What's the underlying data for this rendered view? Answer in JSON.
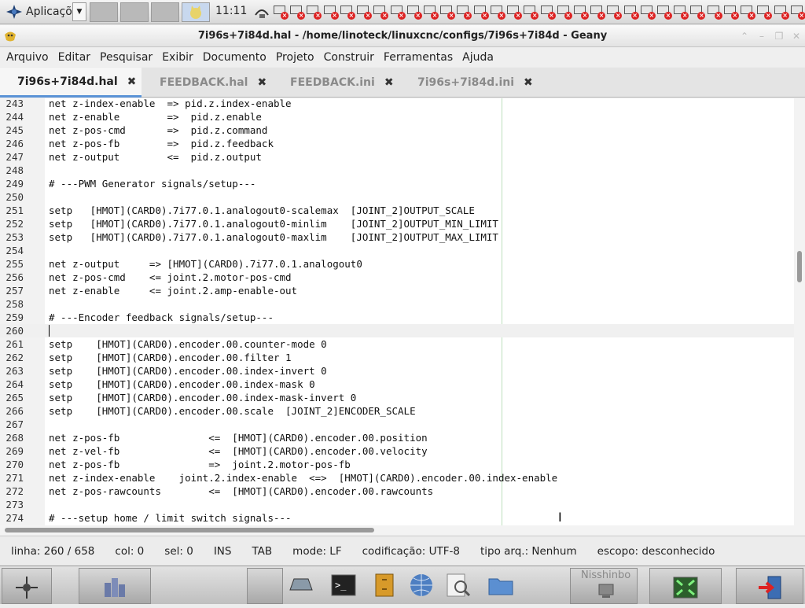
{
  "top_panel": {
    "app_menu_label": "Aplicaçõe",
    "clock": "11:11",
    "tray_count": 32
  },
  "window": {
    "title": "7i96s+7i84d.hal - /home/linoteck/linuxcnc/configs/7i96s+7i84d - Geany"
  },
  "menubar": [
    "Arquivo",
    "Editar",
    "Pesquisar",
    "Exibir",
    "Documento",
    "Projeto",
    "Construir",
    "Ferramentas",
    "Ajuda"
  ],
  "tabs": [
    {
      "label": "7i96s+7i84d.hal",
      "active": true
    },
    {
      "label": "FEEDBACK.hal",
      "active": false
    },
    {
      "label": "FEEDBACK.ini",
      "active": false
    },
    {
      "label": "7i96s+7i84d.ini",
      "active": false
    }
  ],
  "tab_close_glyph": "✖",
  "editor": {
    "current_line": 260,
    "lines": [
      {
        "n": "243",
        "t": "net z-index-enable  => pid.z.index-enable"
      },
      {
        "n": "244",
        "t": "net z-enable        =>  pid.z.enable"
      },
      {
        "n": "245",
        "t": "net z-pos-cmd       =>  pid.z.command"
      },
      {
        "n": "246",
        "t": "net z-pos-fb        =>  pid.z.feedback"
      },
      {
        "n": "247",
        "t": "net z-output        <=  pid.z.output"
      },
      {
        "n": "248",
        "t": ""
      },
      {
        "n": "249",
        "t": "# ---PWM Generator signals/setup---"
      },
      {
        "n": "250",
        "t": ""
      },
      {
        "n": "251",
        "t": "setp   [HMOT](CARD0).7i77.0.1.analogout0-scalemax  [JOINT_2]OUTPUT_SCALE"
      },
      {
        "n": "252",
        "t": "setp   [HMOT](CARD0).7i77.0.1.analogout0-minlim    [JOINT_2]OUTPUT_MIN_LIMIT"
      },
      {
        "n": "253",
        "t": "setp   [HMOT](CARD0).7i77.0.1.analogout0-maxlim    [JOINT_2]OUTPUT_MAX_LIMIT"
      },
      {
        "n": "254",
        "t": ""
      },
      {
        "n": "255",
        "t": "net z-output     => [HMOT](CARD0).7i77.0.1.analogout0"
      },
      {
        "n": "256",
        "t": "net z-pos-cmd    <= joint.2.motor-pos-cmd"
      },
      {
        "n": "257",
        "t": "net z-enable     <= joint.2.amp-enable-out"
      },
      {
        "n": "258",
        "t": ""
      },
      {
        "n": "259",
        "t": "# ---Encoder feedback signals/setup---"
      },
      {
        "n": "260",
        "t": ""
      },
      {
        "n": "261",
        "t": "setp    [HMOT](CARD0).encoder.00.counter-mode 0"
      },
      {
        "n": "262",
        "t": "setp    [HMOT](CARD0).encoder.00.filter 1"
      },
      {
        "n": "263",
        "t": "setp    [HMOT](CARD0).encoder.00.index-invert 0"
      },
      {
        "n": "264",
        "t": "setp    [HMOT](CARD0).encoder.00.index-mask 0"
      },
      {
        "n": "265",
        "t": "setp    [HMOT](CARD0).encoder.00.index-mask-invert 0"
      },
      {
        "n": "266",
        "t": "setp    [HMOT](CARD0).encoder.00.scale  [JOINT_2]ENCODER_SCALE"
      },
      {
        "n": "267",
        "t": ""
      },
      {
        "n": "268",
        "t": "net z-pos-fb               <=  [HMOT](CARD0).encoder.00.position"
      },
      {
        "n": "269",
        "t": "net z-vel-fb               <=  [HMOT](CARD0).encoder.00.velocity"
      },
      {
        "n": "270",
        "t": "net z-pos-fb               =>  joint.2.motor-pos-fb"
      },
      {
        "n": "271",
        "t": "net z-index-enable    joint.2.index-enable  <=>  [HMOT](CARD0).encoder.00.index-enable"
      },
      {
        "n": "272",
        "t": "net z-pos-rawcounts        <=  [HMOT](CARD0).encoder.00.rawcounts"
      },
      {
        "n": "273",
        "t": ""
      },
      {
        "n": "274",
        "t": "# ---setup home / limit switch signals---"
      }
    ]
  },
  "statusbar": {
    "line": "linha: 260 / 658",
    "col": "col: 0",
    "sel": "sel: 0",
    "ins": "INS",
    "tab": "TAB",
    "mode": "mode: LF",
    "encoding": "codificação: UTF-8",
    "filetype": "tipo arq.: Nenhum",
    "scope": "escopo: desconhecido"
  },
  "dock": {
    "nisshinbo_label": "Nisshinbo"
  },
  "colors": {
    "tab_active_underline": "#5b93d6",
    "long_line_marker": "#bde0bd",
    "tray_close": "#dd2222"
  }
}
